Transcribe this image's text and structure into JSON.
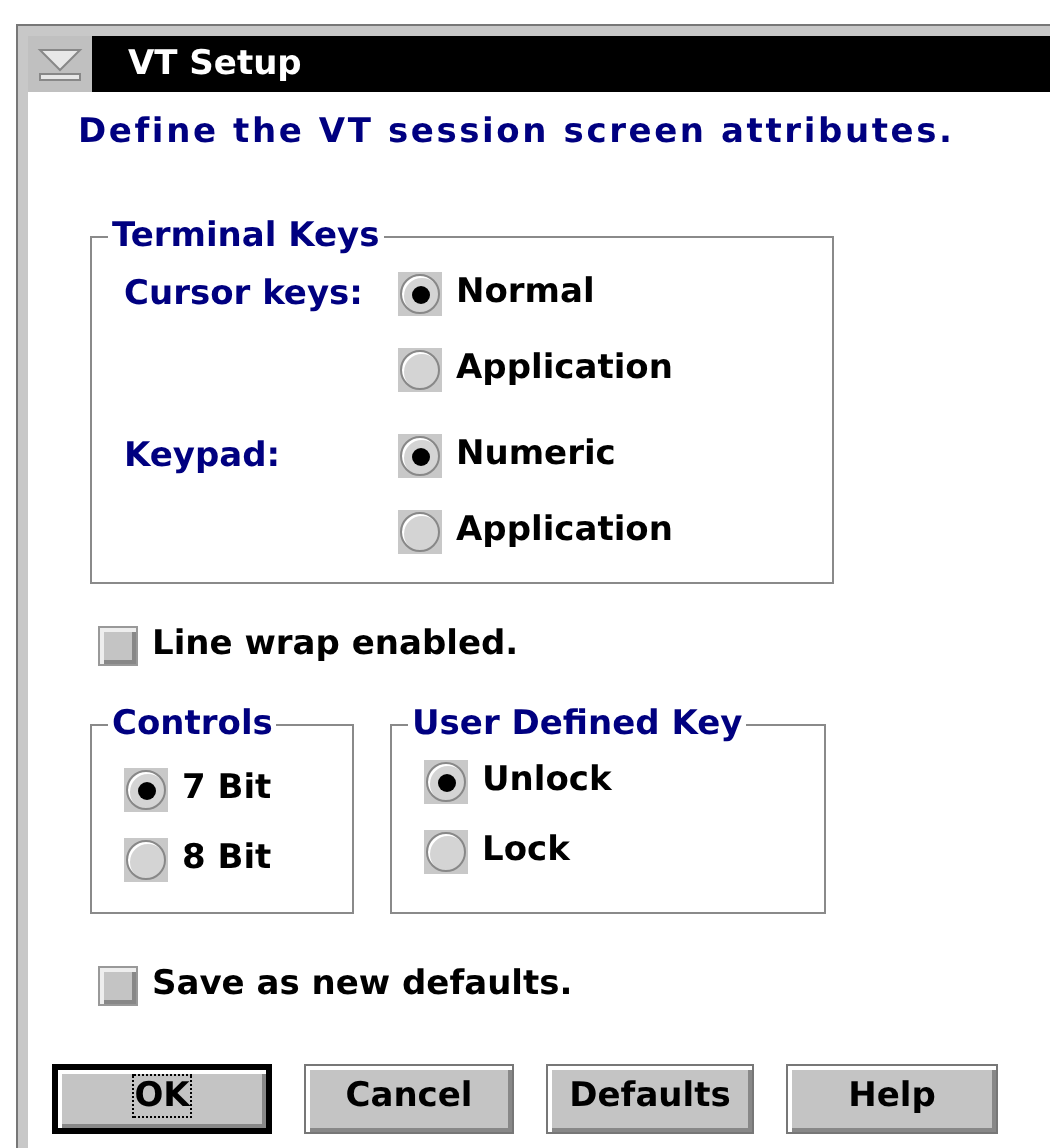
{
  "window": {
    "title": "VT Setup"
  },
  "instruction": "Define the VT session screen attributes.",
  "terminal_keys": {
    "title": "Terminal Keys",
    "groups": [
      {
        "label": "Cursor keys:",
        "options": [
          {
            "label": "Normal",
            "selected": true
          },
          {
            "label": "Application",
            "selected": false
          }
        ]
      },
      {
        "label": "Keypad:",
        "options": [
          {
            "label": "Numeric",
            "selected": true
          },
          {
            "label": "Application",
            "selected": false
          }
        ]
      }
    ]
  },
  "line_wrap": {
    "label": "Line wrap enabled.",
    "checked": false
  },
  "controls": {
    "title": "Controls",
    "options": [
      {
        "label": "7 Bit",
        "selected": true
      },
      {
        "label": "8 Bit",
        "selected": false
      }
    ]
  },
  "user_defined_key": {
    "title": "User Defined Key",
    "options": [
      {
        "label": "Unlock",
        "selected": true
      },
      {
        "label": "Lock",
        "selected": false
      }
    ]
  },
  "save_defaults": {
    "label": "Save as new defaults.",
    "checked": false
  },
  "buttons": [
    {
      "label": "OK",
      "default": true
    },
    {
      "label": "Cancel",
      "default": false
    },
    {
      "label": "Defaults",
      "default": false
    },
    {
      "label": "Help",
      "default": false
    }
  ]
}
